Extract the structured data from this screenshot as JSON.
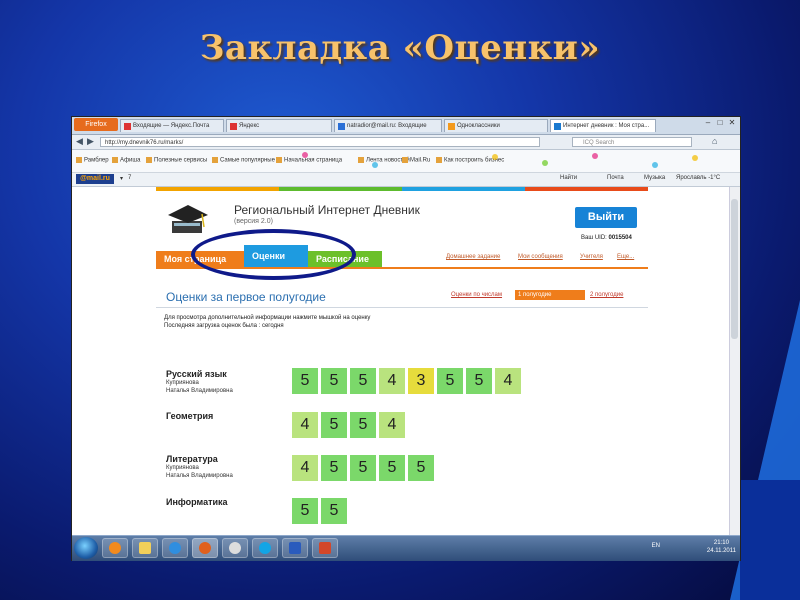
{
  "slide": {
    "title": "Закладка «Оценки»"
  },
  "browser": {
    "firefox_button": "Firefox",
    "tabs": [
      {
        "label": "Входящие — Яндекс.Почта"
      },
      {
        "label": "Яндекс"
      },
      {
        "label": "natradior@mail.ru: Входящие"
      },
      {
        "label": "Одноклассники"
      },
      {
        "label": "Интернет дневник : Моя стра..."
      }
    ],
    "url": "http://my.dnevnik76.ru/marks/",
    "search_placeholder": "ICQ Search",
    "bookmarks": [
      "Рамблер",
      "Афиша",
      "Полезные сервисы",
      "Самые популярные",
      "Начальная страница",
      "Лента новостей",
      "Mail.Ru",
      "Как построить бизнес"
    ],
    "mail_logo": "@mail.ru",
    "mail_counter": "7",
    "mail_toolbar": {
      "find": "Найти",
      "post": "Почта",
      "music": "Музыка",
      "weather": "Ярославль -1°С"
    }
  },
  "site": {
    "title": "Региональный Интернет Дневник",
    "version": "(версия 2.0)",
    "exit_button": "Выйти",
    "uid_label": "Ваш UID:",
    "uid_value": "0015504",
    "tabs": {
      "my_page": "Моя страница",
      "marks": "Оценки",
      "schedule": "Расписание"
    },
    "top_links": [
      "Домашнее задание",
      "Мои сообщения",
      "Учителя",
      "Еще..."
    ]
  },
  "marks_page": {
    "title": "Оценки за первое полугодие",
    "mode_link": "Оценки по числам",
    "half_active": "1 полугодие",
    "half_other": "2 полугодие",
    "hint1": "Для просмотра дополнительной информации нажмите мышкой на оценку",
    "hint2": "Последняя загрузка оценок была : сегодня",
    "subjects": [
      {
        "name": "Русский язык",
        "teacher1": "Куприянова",
        "teacher2": "Наталья Владимировна",
        "grades": [
          "5",
          "5",
          "5",
          "4",
          "3",
          "5",
          "5",
          "4"
        ]
      },
      {
        "name": "Геометрия",
        "teacher1": "",
        "teacher2": "",
        "grades": [
          "4",
          "5",
          "5",
          "4"
        ]
      },
      {
        "name": "Литература",
        "teacher1": "Куприянова",
        "teacher2": "Наталья Владимировна",
        "grades": [
          "4",
          "5",
          "5",
          "5",
          "5"
        ]
      },
      {
        "name": "Информатика",
        "teacher1": "",
        "teacher2": "",
        "grades": [
          "5",
          "5"
        ]
      }
    ]
  },
  "taskbar": {
    "lang": "EN",
    "time": "21:10",
    "date": "24.11.2011"
  },
  "colors": {
    "grade5": "#7bd86a",
    "grade4": "#b9e37e",
    "grade3": "#e6dc3c",
    "accent": "#1783d6",
    "orange": "#ef7d1b"
  }
}
